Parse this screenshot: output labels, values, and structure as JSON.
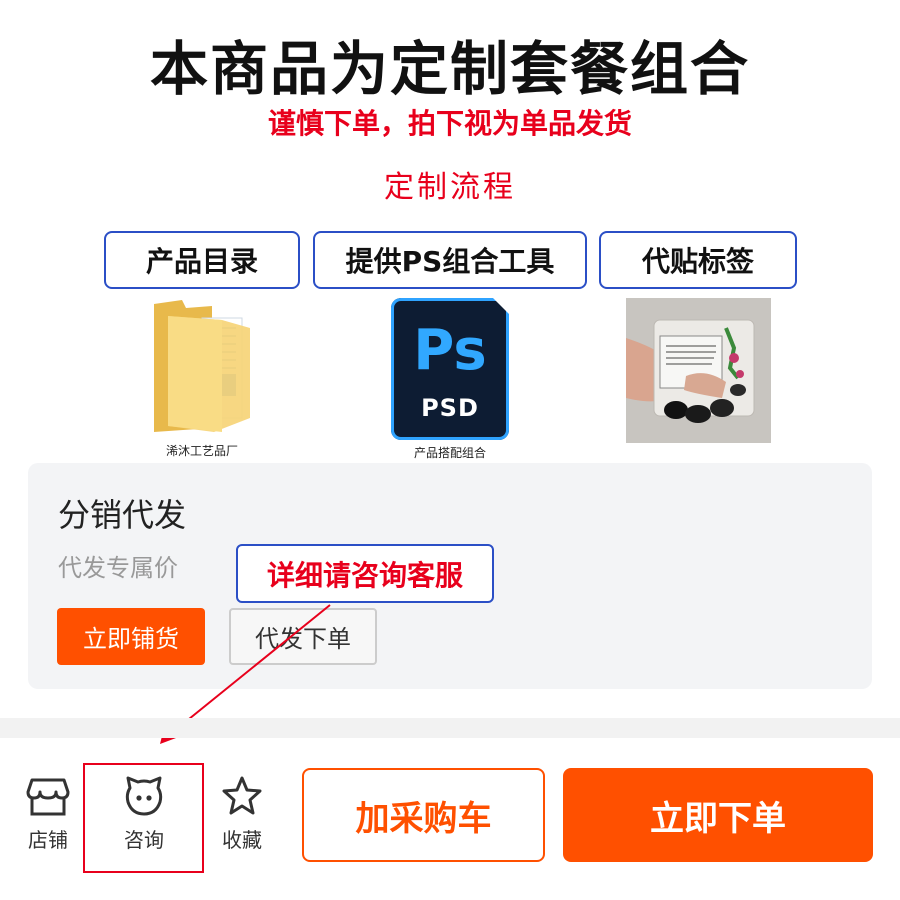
{
  "header": {
    "title": "本商品为定制套餐组合",
    "warning": "谨慎下单，拍下视为单品发货",
    "flow_title": "定制流程"
  },
  "steps": [
    {
      "label": "产品目录",
      "caption": "浠沐工艺品厂",
      "icon": "folder-icon"
    },
    {
      "label": "提供PS组合工具",
      "caption": "产品搭配组合",
      "icon": "photoshop-psd-icon",
      "icon_text": "Ps",
      "icon_subtext": "PSD"
    },
    {
      "label": "代贴标签",
      "caption": "",
      "icon": "labeled-package-photo"
    }
  ],
  "distribution": {
    "title": "分销代发",
    "subtitle": "代发专属价",
    "stock_button": "立即铺货",
    "proxy_button": "代发下单",
    "callout": "详细请咨询客服"
  },
  "bottom_bar": {
    "nav": [
      {
        "label": "店铺",
        "icon": "store-icon"
      },
      {
        "label": "咨询",
        "icon": "chat-face-icon"
      },
      {
        "label": "收藏",
        "icon": "star-icon"
      }
    ],
    "cart_button": "加采购车",
    "buy_button": "立即下单"
  },
  "colors": {
    "accent_orange": "#ff5000",
    "warning_red": "#e8001c",
    "outline_blue": "#2b4fc6"
  }
}
